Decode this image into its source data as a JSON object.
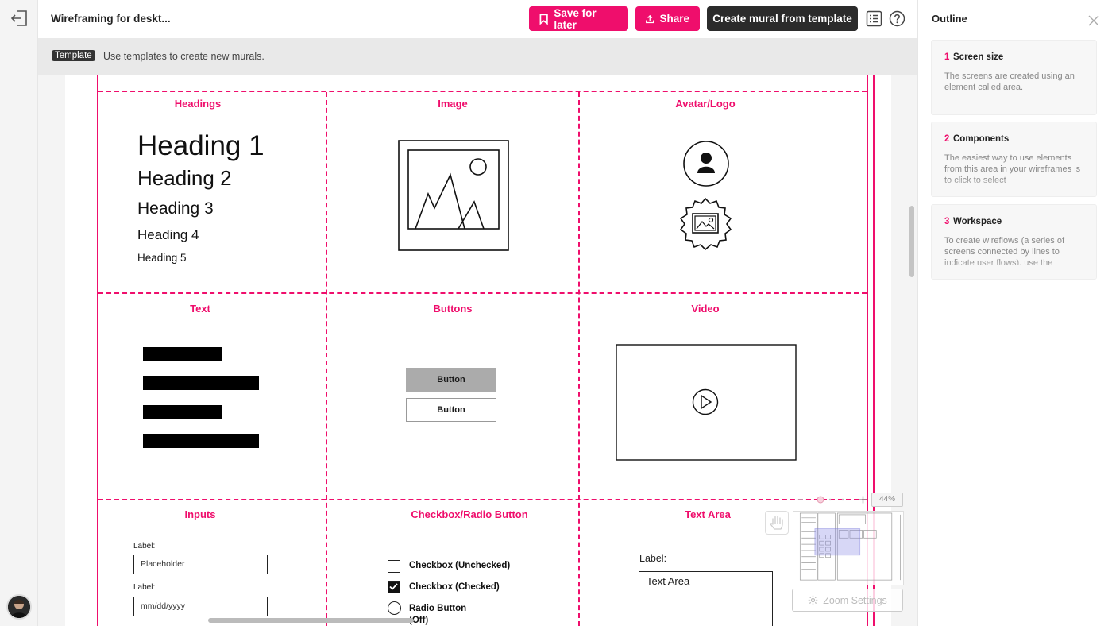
{
  "app": {
    "title": "Wireframing for deskt..."
  },
  "toolbar": {
    "save_label": "Save for later",
    "share_label": "Share",
    "create_label": "Create mural from template",
    "accent": "#ef0e6c"
  },
  "infobar": {
    "tag": "Template",
    "text": "Use templates to create new murals."
  },
  "canvas": {
    "cells": {
      "headings": "Headings",
      "image": "Image",
      "avatar": "Avatar/Logo",
      "text": "Text",
      "buttons": "Buttons",
      "video": "Video",
      "inputs": "Inputs",
      "checkbox": "Checkbox/Radio Button",
      "textarea": "Text Area"
    },
    "headings": [
      "Heading 1",
      "Heading 2",
      "Heading 3",
      "Heading 4",
      "Heading 5"
    ],
    "buttons": [
      "Button",
      "Button"
    ],
    "inputs": [
      {
        "label": "Label:",
        "placeholder": "Placeholder"
      },
      {
        "label": "Label:",
        "placeholder": "mm/dd/yyyy"
      }
    ],
    "checks": {
      "unchecked": "Checkbox (Unchecked)",
      "checked": "Checkbox (Checked)",
      "radio_line1": "Radio Button",
      "radio_line2": "(Off)"
    },
    "textarea": {
      "label": "Label:",
      "value": "Text Area"
    }
  },
  "zoom": {
    "percent": "44%",
    "settings_label": "Zoom Settings"
  },
  "outline": {
    "title": "Outline",
    "items": [
      {
        "num": "1",
        "title": "Screen size",
        "desc": "The screens are created using an element called area."
      },
      {
        "num": "2",
        "title": "Components",
        "desc": "The easiest way to use elements from this area in your wireframes is to click to select"
      },
      {
        "num": "3",
        "title": "Workspace",
        "desc": "To create wireflows (a series of screens connected by lines to indicate user flows), use the"
      }
    ]
  }
}
